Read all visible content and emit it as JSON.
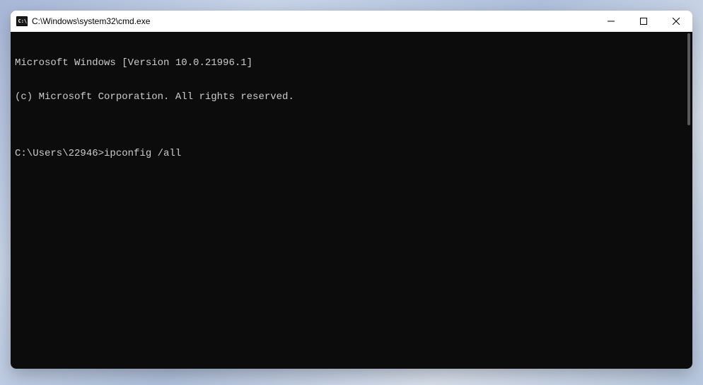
{
  "titlebar": {
    "title": "C:\\Windows\\system32\\cmd.exe"
  },
  "terminal": {
    "line1": "Microsoft Windows [Version 10.0.21996.1]",
    "line2": "(c) Microsoft Corporation. All rights reserved.",
    "blank": "",
    "prompt": "C:\\Users\\22946>",
    "command": "ipconfig /all"
  }
}
